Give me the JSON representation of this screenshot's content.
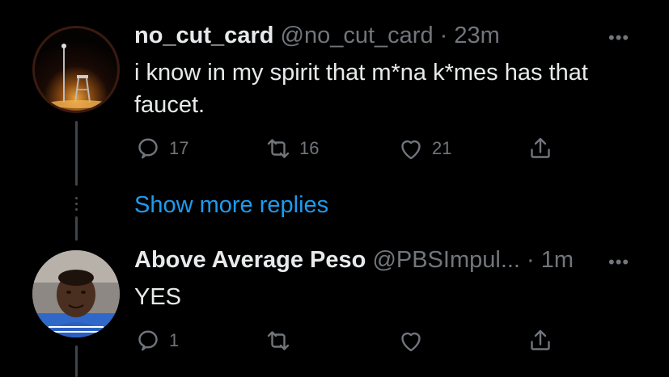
{
  "tweets": [
    {
      "display_name": "no_cut_card",
      "handle": "@no_cut_card",
      "separator": " · ",
      "time": "23m",
      "text": "i know in my spirit that m*na k*mes has that faucet.",
      "reply_count": "17",
      "retweet_count": "16",
      "like_count": "21"
    },
    {
      "display_name": "Above Average Peso",
      "handle": "@PBSImpul...",
      "separator": " · ",
      "time": "1m",
      "text": "YES",
      "reply_count": "1",
      "retweet_count": "",
      "like_count": ""
    }
  ],
  "show_more_label": "Show more replies",
  "more_glyph": "•••",
  "colors": {
    "background": "#000000",
    "text": "#e7e9ea",
    "muted": "#71767b",
    "link": "#1d9bf0"
  },
  "icons": [
    "reply-icon",
    "retweet-icon",
    "like-icon",
    "share-icon",
    "more-icon"
  ]
}
